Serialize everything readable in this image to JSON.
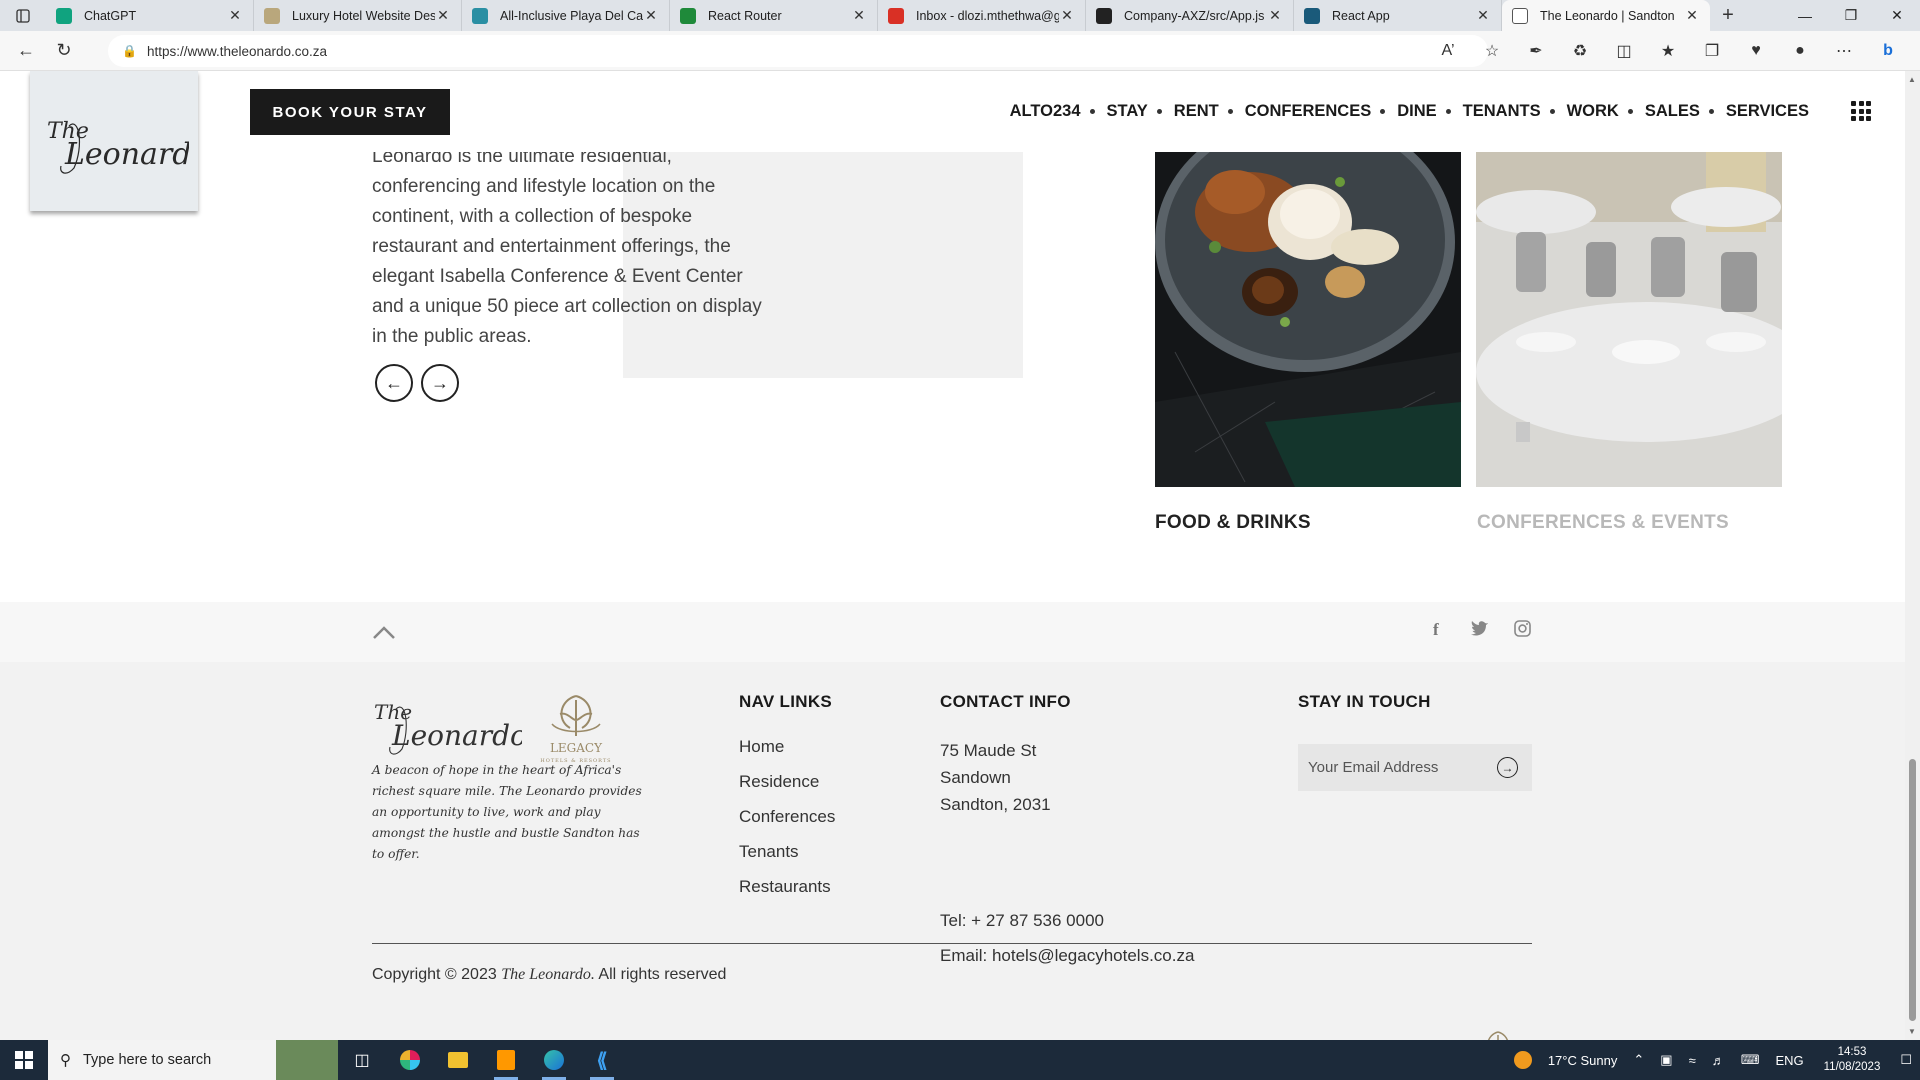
{
  "browser": {
    "tabs": [
      {
        "label": "ChatGPT",
        "favicon_color": "#10a37f"
      },
      {
        "label": "Luxury Hotel Website Desig",
        "favicon_color": "#b9a77c"
      },
      {
        "label": "All-Inclusive Playa Del Carm",
        "favicon_color": "#2a8fa3"
      },
      {
        "label": "React Router",
        "favicon_color": "#1f8a3a"
      },
      {
        "label": "Inbox - dlozi.mthethwa@g",
        "favicon_color": "#d93025"
      },
      {
        "label": "Company-AXZ/src/App.js a",
        "favicon_color": "#222222"
      },
      {
        "label": "React App",
        "favicon_color": "#1a5a7a"
      },
      {
        "label": "The Leonardo | Sandton",
        "favicon_color": "#ffffff"
      }
    ],
    "url": "https://www.theleonardo.co.za"
  },
  "site": {
    "book_button": "BOOK YOUR STAY",
    "nav": [
      "ALTO234",
      "STAY",
      "RENT",
      "CONFERENCES",
      "DINE",
      "TENANTS",
      "WORK",
      "SALES",
      "SERVICES"
    ],
    "intro_text": "Leonardo is the ultimate residential, conferencing and lifestyle location on the continent, with a collection of bespoke restaurant and entertainment offerings, the elegant Isabella Conference & Event Center and a unique 50 piece art collection on display in the public areas.",
    "cards": [
      {
        "title": "FOOD & DRINKS",
        "color": "#1a1a1a"
      },
      {
        "title": "CONFERENCES & EVENTS",
        "color": "#b8b8b8"
      }
    ]
  },
  "footer": {
    "tagline": "A beacon of hope in the heart of Africa's richest square mile. The Leonardo provides an opportunity to live, work and play amongst the hustle and bustle Sandton has to offer.",
    "nav_heading": "NAV LINKS",
    "nav_links": [
      "Home",
      "Residence",
      "Conferences",
      "Tenants",
      "Restaurants"
    ],
    "contact_heading": "CONTACT INFO",
    "address": [
      "75 Maude St",
      "Sandown",
      "Sandton, 2031"
    ],
    "tel": "Tel: + 27 87 536 0000",
    "email": "Email: hotels@legacyhotels.co.za",
    "stay_heading": "STAY IN TOUCH",
    "email_placeholder": "Your Email Address",
    "copyright_prefix": "Copyright © 2023 ",
    "copyright_brand": "The Leonardo.",
    "copyright_suffix": " All rights reserved"
  },
  "taskbar": {
    "search_placeholder": "Type here to search",
    "weather": "17°C  Sunny",
    "language": "ENG",
    "time": "14:53",
    "date": "11/08/2023"
  }
}
